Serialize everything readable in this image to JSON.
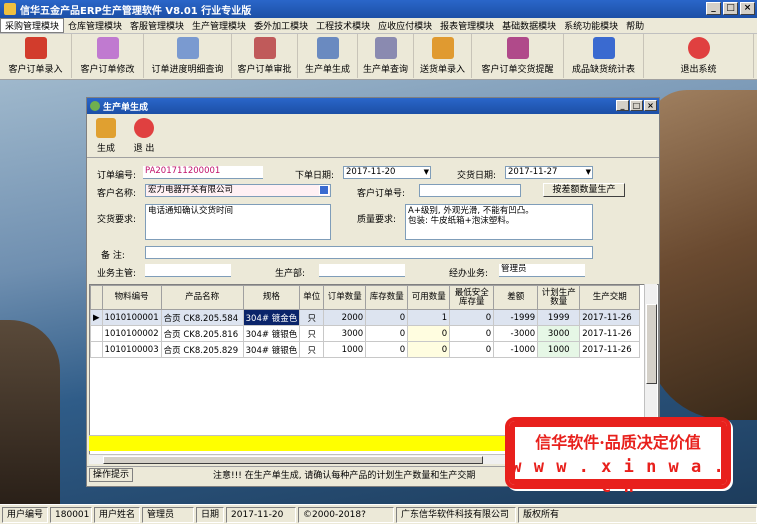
{
  "window": {
    "title": "信华五金产品ERP生产管理软件  V8.01 行业专业版"
  },
  "menu": [
    "采购管理模块",
    "仓库管理模块",
    "客服管理模块",
    "生产管理模块",
    "委外加工模块",
    "工程技术模块",
    "应收应付模块",
    "报表管理模块",
    "基础数据模块",
    "系统功能模块",
    "帮助"
  ],
  "toolbar": [
    {
      "label": "客户订单录入",
      "icon": "pdf-icon",
      "color": "#d23c2c"
    },
    {
      "label": "客户订单修改",
      "icon": "flower-icon",
      "color": "#c07ad0"
    },
    {
      "label": "订单进度明细查询",
      "icon": "pen-icon",
      "color": "#7a9ad0"
    },
    {
      "label": "客户订单审批",
      "icon": "feather-icon",
      "color": "#c05a5a"
    },
    {
      "label": "生产单生成",
      "icon": "rocket-icon",
      "color": "#6a8ac0"
    },
    {
      "label": "生产单查询",
      "icon": "drawing-icon",
      "color": "#8a8ab0"
    },
    {
      "label": "送货单录入",
      "icon": "sun-flower-icon",
      "color": "#e09a30"
    },
    {
      "label": "客户订单交货提醒",
      "icon": "quill-icon",
      "color": "#b04a8a"
    },
    {
      "label": "成品缺货统计表",
      "icon": "blue-feather-icon",
      "color": "#3a6ad0"
    },
    {
      "label": "退出系统",
      "icon": "power-icon",
      "color": "#e04040"
    }
  ],
  "child": {
    "title": "生产单生成",
    "tools": [
      {
        "label": "生成",
        "icon": "generate-icon",
        "color": "#e0a030"
      },
      {
        "label": "退 出",
        "icon": "exit-icon",
        "color": "#e04040"
      }
    ],
    "form": {
      "order_no_label": "订单编号:",
      "order_no": "PA201711200001",
      "order_date_label": "下单日期:",
      "order_date": "2017-11-20",
      "delivery_date_label": "交货日期:",
      "delivery_date": "2017-11-27",
      "customer_label": "客户名称:",
      "customer": "宏力电器开关有限公司",
      "customer_po_label": "客户订单号:",
      "customer_po": "",
      "gen_button": "按差额数量生产",
      "delivery_req_label": "交货要求:",
      "delivery_req": "电话通知确认交货时间",
      "quality_req_label": "质量要求:",
      "quality_req_1": "A+级别, 外观光滑, 不能有凹凸。",
      "quality_req_2": "包装: 牛皮纸箱+泡沫塑料。",
      "remark_label": "备    注:",
      "remark": "",
      "manager_label": "业务主管:",
      "manager": "",
      "dept_label": "生产部:",
      "dept": "",
      "handler_label": "经办业务:",
      "handler": "管理员"
    },
    "table": {
      "headers": [
        "物料编号",
        "产品名称",
        "规格",
        "单位",
        "订单数量",
        "库存数量",
        "可用数量",
        "最低安全库存量",
        "差额",
        "计划生产数量",
        "生产交期"
      ],
      "rows": [
        [
          "1010100001",
          "合页 CK8.205.584",
          "304# 镀金色",
          "只",
          "2000",
          "0",
          "1",
          "0",
          "-1999",
          "1999",
          "2017-11-26"
        ],
        [
          "1010100002",
          "合页 CK8.205.816",
          "304# 镀银色",
          "只",
          "3000",
          "0",
          "0",
          "0",
          "-3000",
          "3000",
          "2017-11-26"
        ],
        [
          "1010100003",
          "合页 CK8.205.829",
          "304# 镀银色",
          "只",
          "1000",
          "0",
          "0",
          "0",
          "-1000",
          "1000",
          "2017-11-26"
        ]
      ]
    },
    "status": {
      "op_label": "操作提示",
      "message": "注意!!!  在生产单生成, 请确认每种产品的计划生产数量和生产交期"
    }
  },
  "promo": {
    "line1": "信华软件·品质决定价值",
    "line2": "w w w . x i n w a . c n"
  },
  "statusbar": [
    {
      "label": "用户编号"
    },
    {
      "label": "180001"
    },
    {
      "label": "用户姓名"
    },
    {
      "label": "管理员"
    },
    {
      "label": "日期"
    },
    {
      "label": "2017-11-20"
    },
    {
      "label": "©2000-2018?"
    },
    {
      "label": "广东信华软件科技有限公司"
    },
    {
      "label": "版权所有"
    }
  ]
}
